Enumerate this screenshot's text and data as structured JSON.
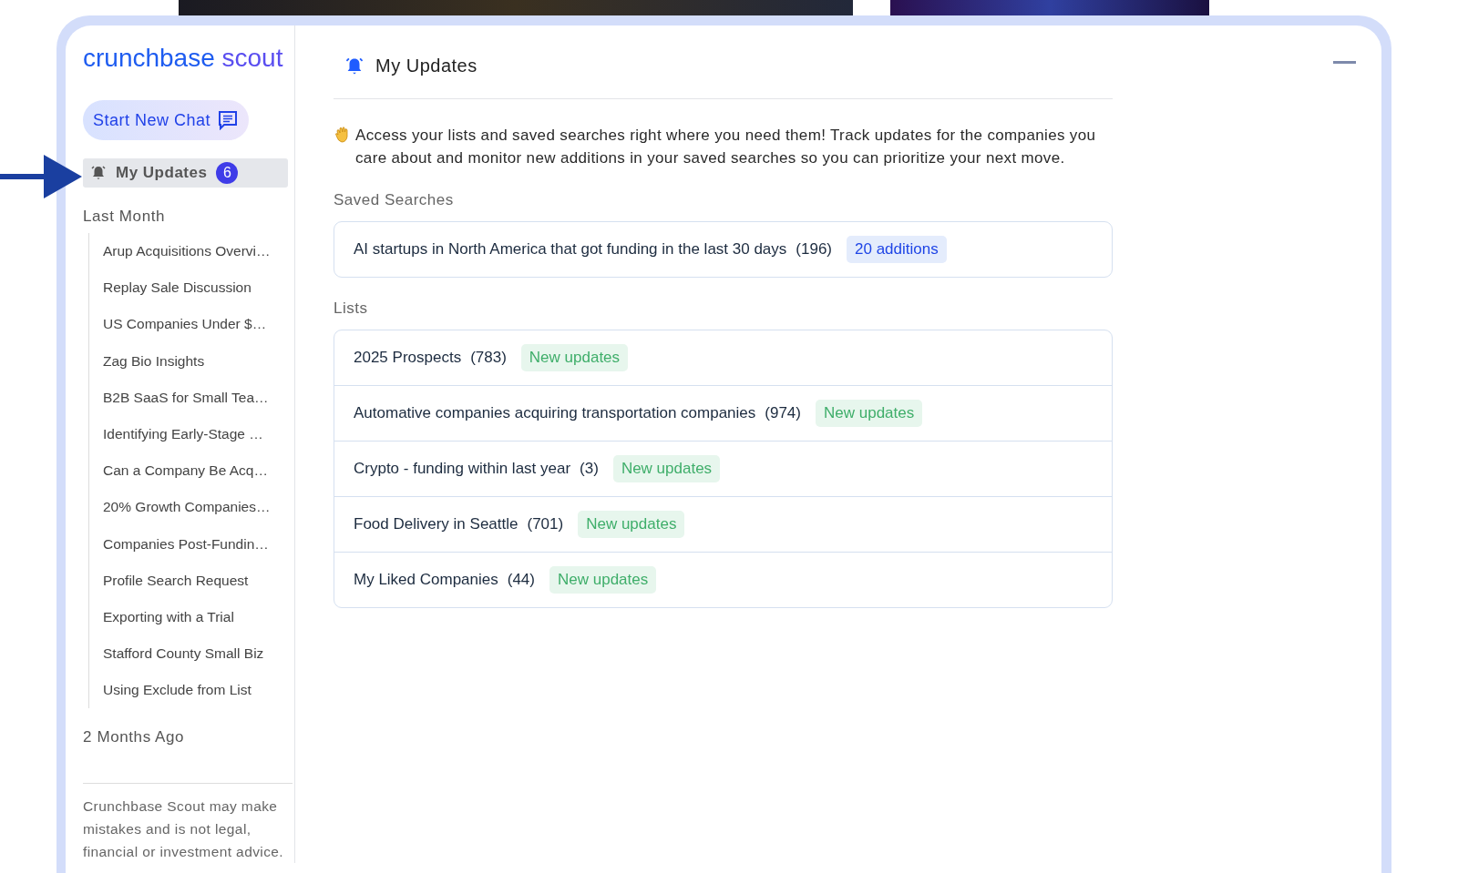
{
  "logo": {
    "brand": "crunchbase",
    "product": "scout"
  },
  "sidebar": {
    "new_chat": "Start New Chat",
    "nav": [
      {
        "label": "My Updates",
        "badge": "6",
        "selected": true
      }
    ],
    "groups": [
      {
        "title": "Last Month",
        "items": [
          "Arup Acquisitions Overvi…",
          "Replay Sale Discussion",
          "US Companies Under $…",
          "Zag Bio Insights",
          "B2B SaaS for Small Tea…",
          "Identifying Early-Stage …",
          "Can a Company Be Acq…",
          "20% Growth Companies…",
          "Companies Post-Fundin…",
          "Profile Search Request",
          "Exporting with a Trial",
          "Stafford County Small Biz",
          "Using Exclude from List"
        ]
      },
      {
        "title": "2 Months Ago"
      }
    ],
    "disclaimer": "Crunchbase Scout may make mistakes and is not legal, financial or investment advice."
  },
  "main": {
    "title": "My Updates",
    "intro": "Access your lists and saved searches right where you need them! Track updates for the companies you care about and monitor new additions in your saved searches so you can prioritize your next move.",
    "sections": [
      {
        "title": "Saved Searches",
        "items": [
          {
            "name": "AI startups in North America that got funding in the last 30 days",
            "count": "(196)",
            "tag": "20 additions",
            "kind": "additions"
          }
        ]
      },
      {
        "title": "Lists",
        "items": [
          {
            "name": "2025 Prospects",
            "count": "(783)",
            "tag": "New updates",
            "kind": "updates"
          },
          {
            "name": "Automative companies acquiring transportation companies",
            "count": "(974)",
            "tag": "New updates",
            "kind": "updates"
          },
          {
            "name": "Crypto - funding within last year",
            "count": "(3)",
            "tag": "New updates",
            "kind": "updates"
          },
          {
            "name": "Food Delivery in Seattle",
            "count": "(701)",
            "tag": "New updates",
            "kind": "updates"
          },
          {
            "name": "My Liked Companies",
            "count": "(44)",
            "tag": "New updates",
            "kind": "updates"
          }
        ]
      }
    ]
  }
}
